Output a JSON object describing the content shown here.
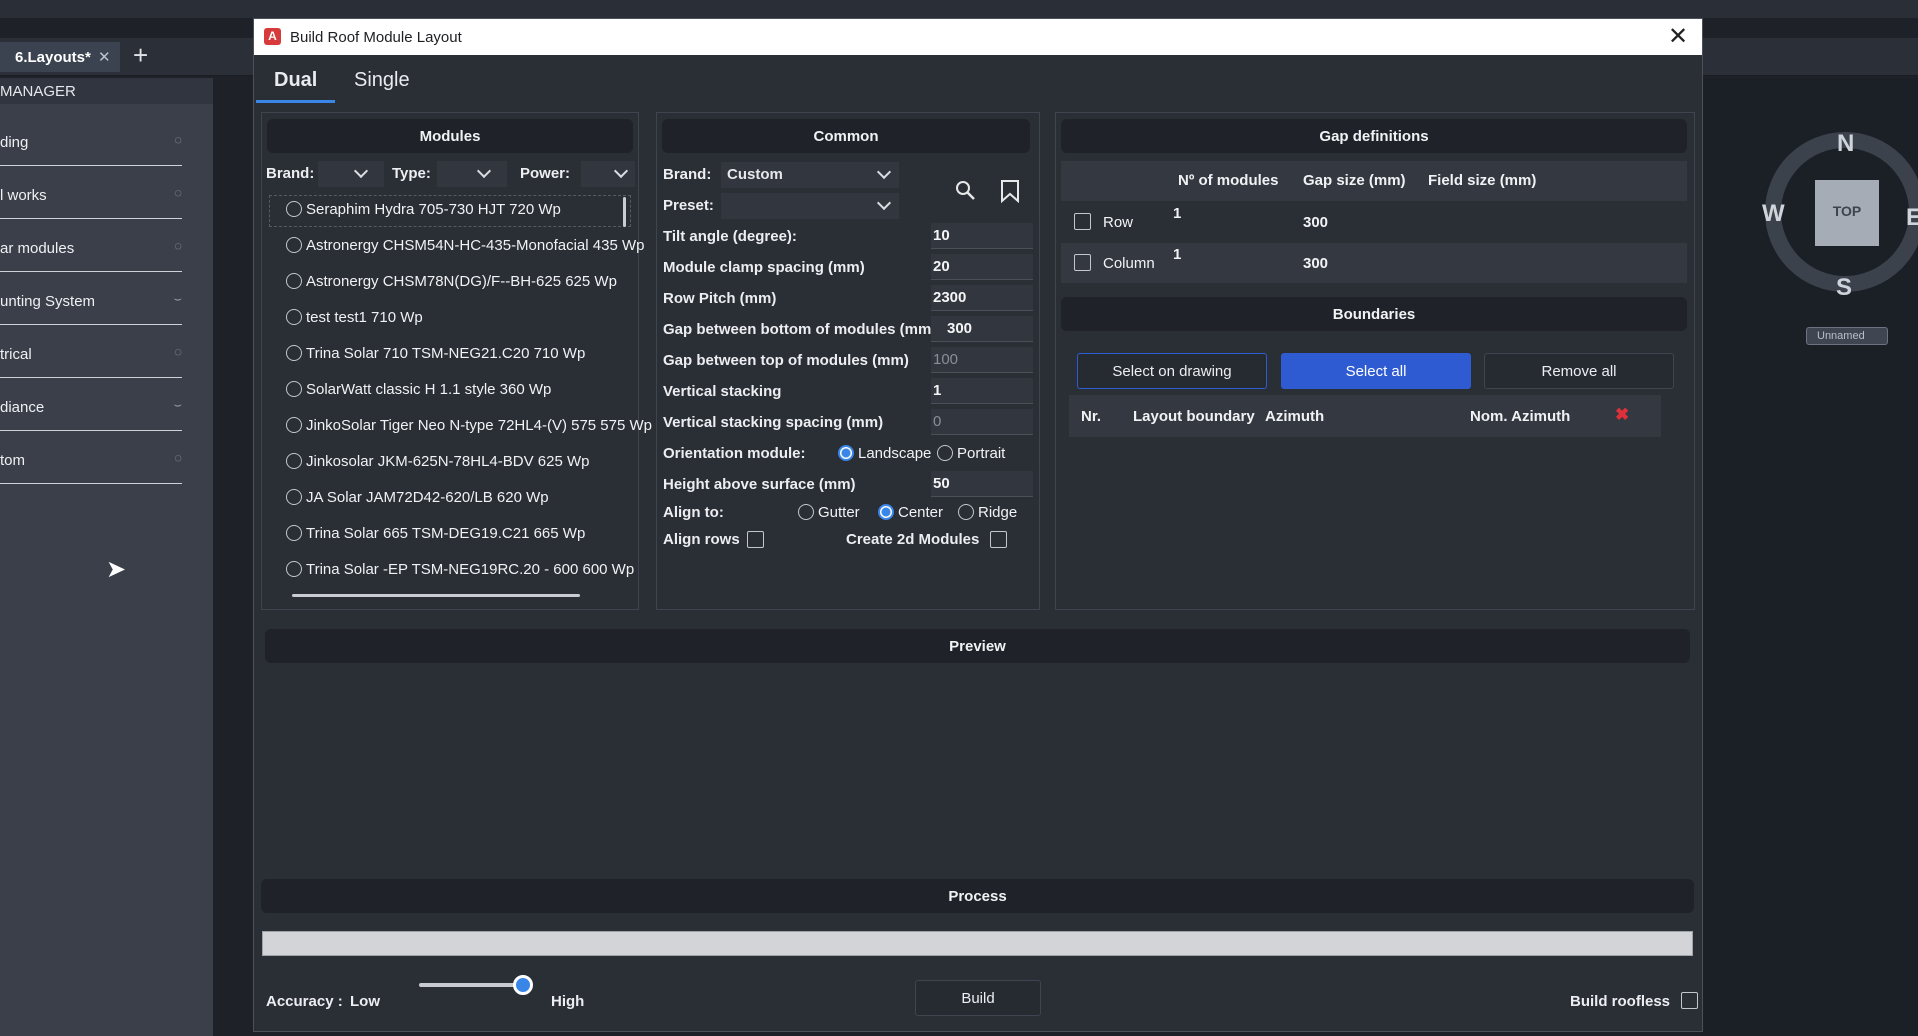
{
  "background": {
    "doc_tab": "6.Layouts*",
    "panel_title": "MANAGER",
    "panel_items": [
      "ding",
      "l works",
      "ar modules",
      "unting System",
      "trical",
      "diance",
      "tom"
    ],
    "compass": {
      "n": "N",
      "s": "S",
      "w": "W",
      "e": "E",
      "cube": "TOP",
      "view_name": "Unnamed"
    }
  },
  "dialog": {
    "title": "Build Roof Module Layout",
    "tabs": [
      "Dual",
      "Single"
    ],
    "modules": {
      "header": "Modules",
      "brand_label": "Brand:",
      "type_label": "Type:",
      "power_label": "Power:",
      "items": [
        "Seraphim Hydra 705-730 HJT 720 Wp",
        "Astronergy CHSM54N-HC-435-Monofacial 435 Wp",
        "Astronergy CHSM78N(DG)/F--BH-625 625 Wp",
        "test test1 710 Wp",
        "Trina Solar 710 TSM-NEG21.C20 710 Wp",
        "SolarWatt classic H 1.1 style 360 Wp",
        "JinkoSolar Tiger Neo N-type 72HL4-(V) 575 575 Wp",
        "Jinkosolar JKM-625N-78HL4-BDV 625 Wp",
        "JA Solar JAM72D42-620/LB 620 Wp",
        "Trina Solar 665 TSM-DEG19.C21 665 Wp",
        "Trina Solar -EP TSM-NEG19RC.20 - 600 600 Wp"
      ]
    },
    "common": {
      "header": "Common",
      "brand_label": "Brand:",
      "brand_value": "Custom",
      "preset_label": "Preset:",
      "tilt_label": "Tilt angle (degree):",
      "tilt": "10",
      "clamp_label": "Module clamp spacing (mm)",
      "clamp": "20",
      "pitch_label": "Row Pitch (mm)",
      "pitch": "2300",
      "gap_bottom_label": "Gap between bottom of modules (mm)",
      "gap_bottom": "300",
      "gap_top_label": "Gap between top of modules (mm)",
      "gap_top": "100",
      "vstack_label": "Vertical stacking",
      "vstack": "1",
      "vstack_spacing_label": "Vertical stacking spacing (mm)",
      "vstack_spacing": "0",
      "orientation_label": "Orientation module:",
      "landscape": "Landscape",
      "portrait": "Portrait",
      "height_label": "Height above surface (mm)",
      "height": "50",
      "align_label": "Align to:",
      "gutter": "Gutter",
      "center": "Center",
      "ridge": "Ridge",
      "align_rows": "Align rows",
      "create_2d": "Create 2d Modules"
    },
    "gaps": {
      "header": "Gap definitions",
      "col_modules": "Nº of modules",
      "col_gap": "Gap size (mm)",
      "col_field": "Field size (mm)",
      "rows": [
        {
          "label": "Row",
          "modules": "1",
          "gap": "300"
        },
        {
          "label": "Column",
          "modules": "1",
          "gap": "300"
        }
      ]
    },
    "boundaries": {
      "header": "Boundaries",
      "select_on_drawing": "Select on drawing",
      "select_all": "Select all",
      "remove_all": "Remove all",
      "col_nr": "Nr.",
      "col_layout": "Layout boundary",
      "col_azimuth": "Azimuth",
      "col_nom_azimuth": "Nom. Azimuth"
    },
    "preview": "Preview",
    "process": "Process",
    "progress": 0,
    "accuracy_label": "Accuracy :",
    "low": "Low",
    "high": "High",
    "accuracy_level": 1.0,
    "build": "Build",
    "build_roofless": "Build roofless"
  }
}
